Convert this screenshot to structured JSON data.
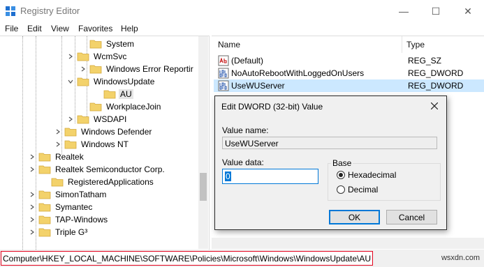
{
  "window": {
    "title": "Registry Editor",
    "minimize": "—",
    "maximize": "☐",
    "close": "✕"
  },
  "menu": [
    "File",
    "Edit",
    "View",
    "Favorites",
    "Help"
  ],
  "tree": [
    {
      "label": "System",
      "expander": "",
      "selected": false
    },
    {
      "label": "WcmSvc",
      "expander": "right",
      "selected": false
    },
    {
      "label": "Windows Error Reportir",
      "expander": "right",
      "selected": false
    },
    {
      "label": "WindowsUpdate",
      "expander": "down",
      "selected": false
    },
    {
      "label": "AU",
      "expander": "",
      "selected": true
    },
    {
      "label": "WorkplaceJoin",
      "expander": "",
      "selected": false
    },
    {
      "label": "WSDAPI",
      "expander": "right",
      "selected": false
    },
    {
      "label": "Windows Defender",
      "expander": "right",
      "selected": false
    },
    {
      "label": "Windows NT",
      "expander": "right",
      "selected": false
    },
    {
      "label": "Realtek",
      "expander": "right",
      "selected": false
    },
    {
      "label": "Realtek Semiconductor Corp.",
      "expander": "right",
      "selected": false
    },
    {
      "label": "RegisteredApplications",
      "expander": "",
      "selected": false
    },
    {
      "label": "SimonTatham",
      "expander": "right",
      "selected": false
    },
    {
      "label": "Symantec",
      "expander": "right",
      "selected": false
    },
    {
      "label": "TAP-Windows",
      "expander": "right",
      "selected": false
    },
    {
      "label": "Triple G³",
      "expander": "right",
      "selected": false
    }
  ],
  "list": {
    "columns": {
      "name": "Name",
      "type": "Type"
    },
    "rows": [
      {
        "name": "(Default)",
        "type": "REG_SZ",
        "icon": "string-value-icon"
      },
      {
        "name": "NoAutoRebootWithLoggedOnUsers",
        "type": "REG_DWORD",
        "icon": "binary-value-icon"
      },
      {
        "name": "UseWUServer",
        "type": "REG_DWORD",
        "icon": "binary-value-icon"
      }
    ]
  },
  "dialog": {
    "title": "Edit DWORD (32-bit) Value",
    "value_name_label": "Value name:",
    "value_name": "UseWUServer",
    "value_data_label": "Value data:",
    "value_data": "0",
    "base_label": "Base",
    "hex_label": "Hexadecimal",
    "dec_label": "Decimal",
    "base_selected": "Hexadecimal",
    "ok_label": "OK",
    "cancel_label": "Cancel"
  },
  "status": {
    "path": "Computer\\HKEY_LOCAL_MACHINE\\SOFTWARE\\Policies\\Microsoft\\Windows\\WindowsUpdate\\AU",
    "watermark": "wsxdn.com"
  },
  "colors": {
    "selection": "#cce8ff",
    "folder": "#f3d26b",
    "accent": "#0078d7",
    "highlight_border": "#e3001b"
  }
}
